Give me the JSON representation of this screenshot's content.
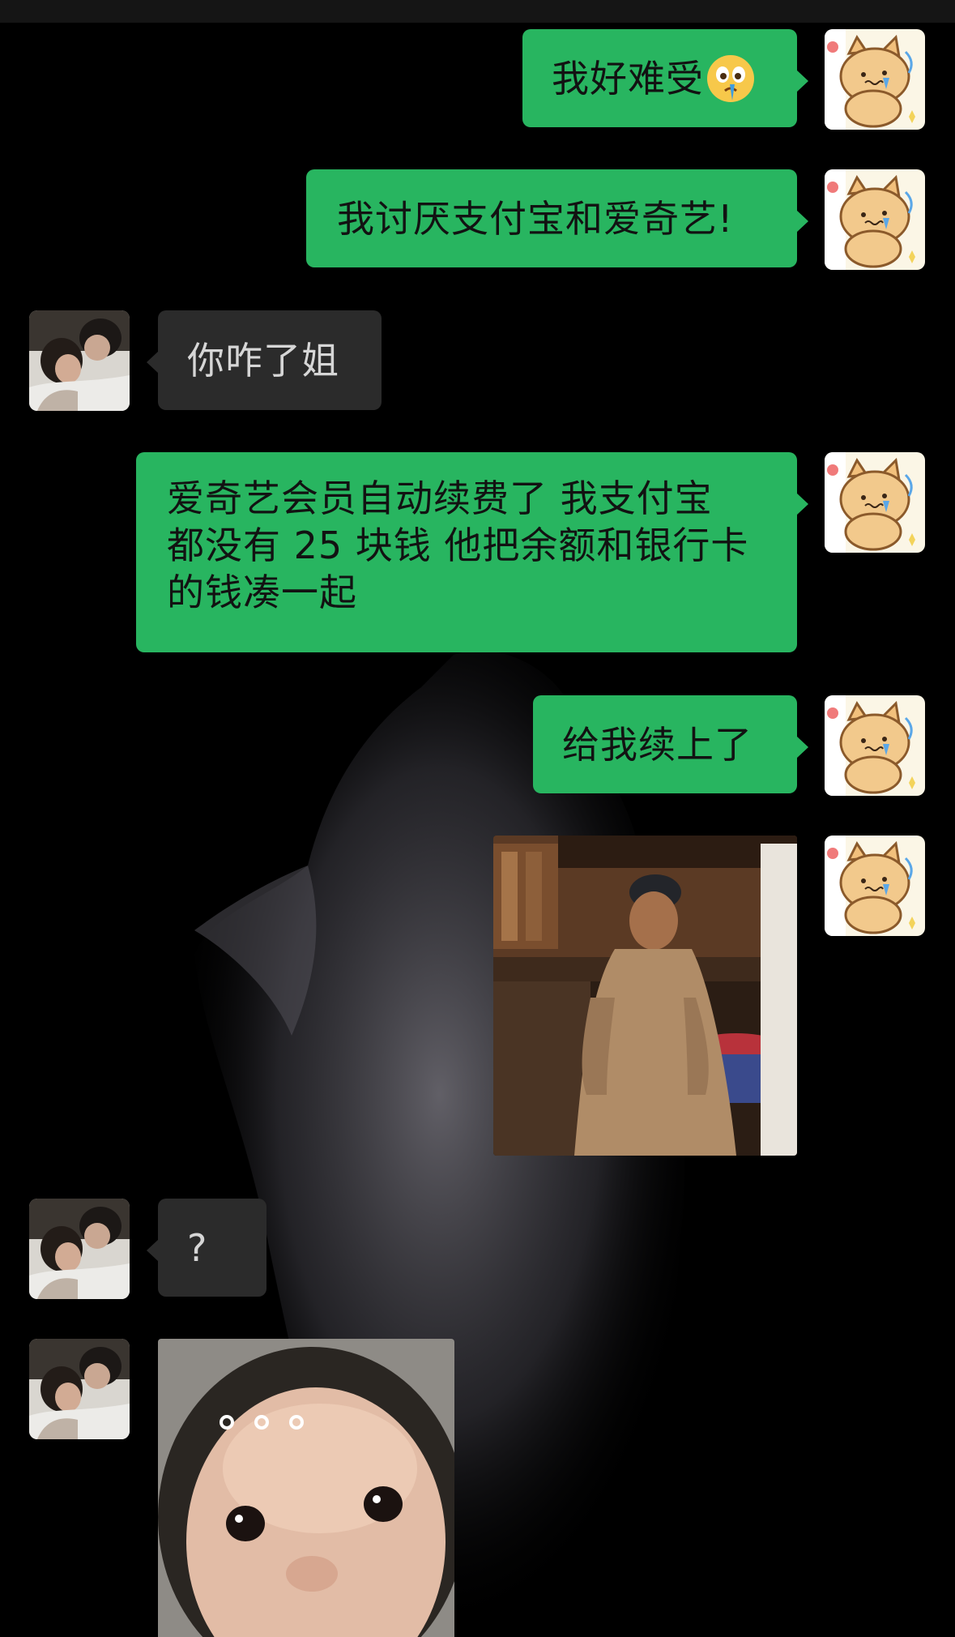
{
  "conversation": {
    "messages": [
      {
        "id": "m1",
        "sender": "self",
        "type": "text",
        "text": "我好难受",
        "emoji": "crying-face-emoji"
      },
      {
        "id": "m2",
        "sender": "self",
        "type": "text",
        "text": "我讨厌支付宝和爱奇艺!"
      },
      {
        "id": "m3",
        "sender": "friend",
        "type": "text",
        "text": "你咋了姐"
      },
      {
        "id": "m4",
        "sender": "self",
        "type": "text",
        "text": "爱奇艺会员自动续费了 我支付宝\n都没有 25 块钱 他把余额和银行卡\n的钱凑一起"
      },
      {
        "id": "m5",
        "sender": "self",
        "type": "text",
        "text": "给我续上了"
      },
      {
        "id": "m6",
        "sender": "self",
        "type": "image",
        "icon": "monk-meme-sticker"
      },
      {
        "id": "m7",
        "sender": "friend",
        "type": "text",
        "text": "?"
      },
      {
        "id": "m8",
        "sender": "friend",
        "type": "image",
        "icon": "baby-face-sticker"
      }
    ]
  },
  "avatars": {
    "self": "cat-cartoon-avatar",
    "friend": "couple-photo-avatar"
  },
  "colors": {
    "background": "#000000",
    "outgoing_bubble": "#28b560",
    "incoming_bubble": "#2b2b2b",
    "incoming_text": "#d6d6d6"
  }
}
